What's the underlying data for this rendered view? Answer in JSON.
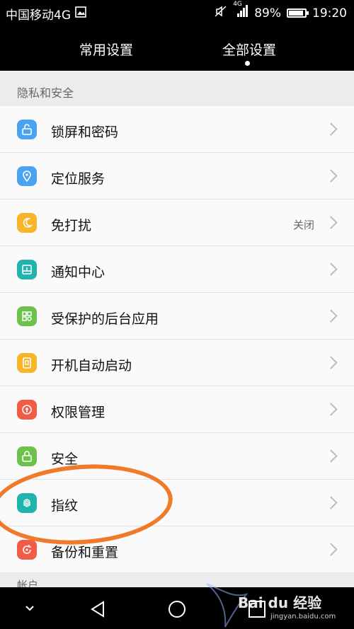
{
  "status_bar": {
    "carrier": "中国移动4G",
    "signal_label": "4G",
    "battery_percent": "89%",
    "battery_level": 0.89,
    "time": "19:20"
  },
  "tabs": {
    "common": "常用设置",
    "all": "全部设置"
  },
  "section": {
    "title": "隐私和安全"
  },
  "items": [
    {
      "label": "锁屏和密码",
      "icon": "unlock-icon",
      "color": "#4aa3f0"
    },
    {
      "label": "定位服务",
      "icon": "location-pin-icon",
      "color": "#4aa3f0"
    },
    {
      "label": "免打扰",
      "icon": "moon-icon",
      "color": "#f7b52a",
      "value": "关闭"
    },
    {
      "label": "通知中心",
      "icon": "notification-icon",
      "color": "#21b4ae"
    },
    {
      "label": "受保护的后台应用",
      "icon": "protected-apps-icon",
      "color": "#6cc24a"
    },
    {
      "label": "开机自动启动",
      "icon": "autostart-icon",
      "color": "#f7b52a"
    },
    {
      "label": "权限管理",
      "icon": "permission-icon",
      "color": "#f25b45"
    },
    {
      "label": "安全",
      "icon": "lock-icon",
      "color": "#6cc24a"
    },
    {
      "label": "指纹",
      "icon": "fingerprint-icon",
      "color": "#21b4ae"
    },
    {
      "label": "备份和重置",
      "icon": "backup-icon",
      "color": "#f25b45"
    }
  ],
  "section2": {
    "title": "帐户"
  },
  "watermark": {
    "text": "Bai du 经验",
    "url": "jingyan.baidu.com"
  },
  "colors": {
    "annotation": "#f07a2a"
  }
}
